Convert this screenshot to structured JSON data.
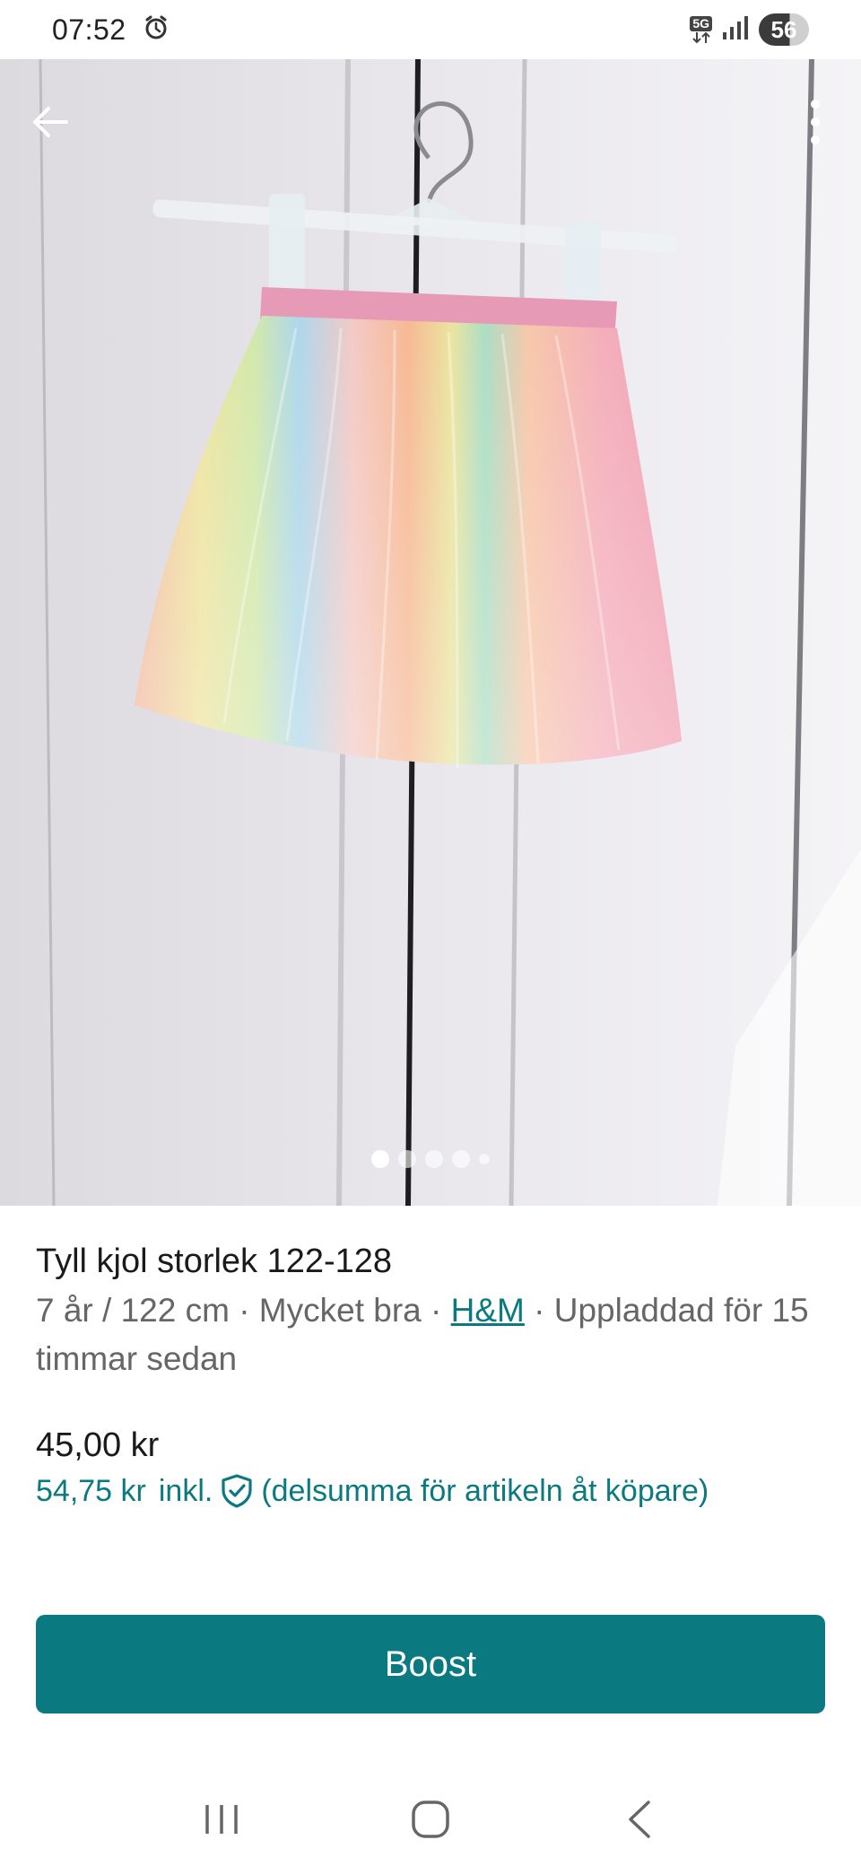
{
  "status": {
    "time": "07:52",
    "network": "5G",
    "battery": "56"
  },
  "gallery": {
    "image_count": 5,
    "active_index": 0
  },
  "listing": {
    "title": "Tyll kjol storlek 122-128",
    "meta_prefix": "7 år / 122 cm · Mycket bra · ",
    "brand": "H&M",
    "meta_suffix": " · Uppladdad för 15 timmar sedan",
    "price": "45,00 kr",
    "price_incl": "54,75 kr",
    "incl_label": "inkl.",
    "incl_note": "(delsumma för artikeln åt köpare)"
  },
  "actions": {
    "boost_label": "Boost"
  },
  "colors": {
    "accent": "#0b7a80"
  },
  "icons": {
    "back": "arrow-left-icon",
    "more": "more-vertical-icon",
    "shield": "shield-check-icon",
    "alarm": "alarm-icon",
    "signal": "signal-icon",
    "nav_recents": "recents-icon",
    "nav_home": "home-icon",
    "nav_back": "chevron-left-icon"
  }
}
